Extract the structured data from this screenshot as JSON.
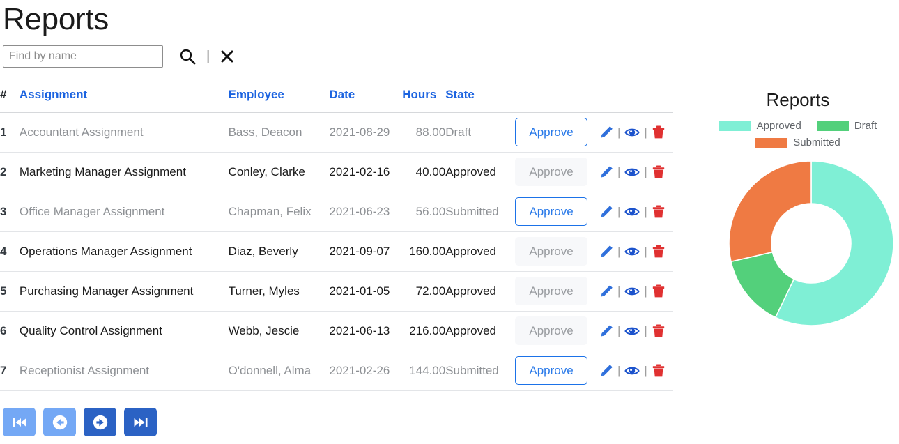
{
  "page": {
    "title": "Reports"
  },
  "search": {
    "value": "",
    "placeholder": "Find by name",
    "search_icon": "search-icon",
    "clear_icon": "close-icon",
    "separator": "|"
  },
  "table": {
    "headers": {
      "num": "#",
      "assignment": "Assignment",
      "employee": "Employee",
      "date": "Date",
      "hours": "Hours",
      "state": "State"
    },
    "approve_label": "Approve",
    "action_separator": "|",
    "action_icons": [
      "edit-icon",
      "view-icon",
      "delete-icon"
    ],
    "rows": [
      {
        "num": "1",
        "assignment": "Accountant Assignment",
        "employee": "Bass, Deacon",
        "date": "2021-08-29",
        "hours": "88.00",
        "state": "Draft",
        "approve_enabled": true
      },
      {
        "num": "2",
        "assignment": "Marketing Manager Assignment",
        "employee": "Conley, Clarke",
        "date": "2021-02-16",
        "hours": "40.00",
        "state": "Approved",
        "approve_enabled": false
      },
      {
        "num": "3",
        "assignment": "Office Manager Assignment",
        "employee": "Chapman, Felix",
        "date": "2021-06-23",
        "hours": "56.00",
        "state": "Submitted",
        "approve_enabled": true
      },
      {
        "num": "4",
        "assignment": "Operations Manager Assignment",
        "employee": "Diaz, Beverly",
        "date": "2021-09-07",
        "hours": "160.00",
        "state": "Approved",
        "approve_enabled": false
      },
      {
        "num": "5",
        "assignment": "Purchasing Manager Assignment",
        "employee": "Turner, Myles",
        "date": "2021-01-05",
        "hours": "72.00",
        "state": "Approved",
        "approve_enabled": false
      },
      {
        "num": "6",
        "assignment": "Quality Control Assignment",
        "employee": "Webb, Jescie",
        "date": "2021-06-13",
        "hours": "216.00",
        "state": "Approved",
        "approve_enabled": false
      },
      {
        "num": "7",
        "assignment": "Receptionist Assignment",
        "employee": "O'donnell, Alma",
        "date": "2021-02-26",
        "hours": "144.00",
        "state": "Submitted",
        "approve_enabled": true
      }
    ]
  },
  "pagination": {
    "buttons": [
      {
        "name": "first-page-button",
        "icon": "skip-to-start-icon",
        "style": "light"
      },
      {
        "name": "previous-page-button",
        "icon": "arrow-left-circle-icon",
        "style": "light"
      },
      {
        "name": "next-page-button",
        "icon": "arrow-right-circle-icon",
        "style": "dark"
      },
      {
        "name": "last-page-button",
        "icon": "skip-to-end-icon",
        "style": "dark"
      }
    ]
  },
  "colors": {
    "approved": "#7FEFD5",
    "draft": "#53D07B",
    "submitted": "#EF7A43",
    "link_blue": "#1b63e0",
    "button_blue": "#2a7ae9",
    "delete_red": "#e03131",
    "page_light": "#74a8f5",
    "page_dark": "#2b62c4"
  },
  "chart_data": {
    "type": "pie",
    "variant": "donut",
    "title": "Reports",
    "legend_position": "top",
    "categories": [
      "Approved",
      "Draft",
      "Submitted"
    ],
    "values": [
      4,
      1,
      2
    ],
    "percentages": [
      57.1,
      14.3,
      28.6
    ],
    "colors": [
      "#7FEFD5",
      "#53D07B",
      "#EF7A43"
    ],
    "total": 7,
    "xlabel": "",
    "ylabel": ""
  }
}
